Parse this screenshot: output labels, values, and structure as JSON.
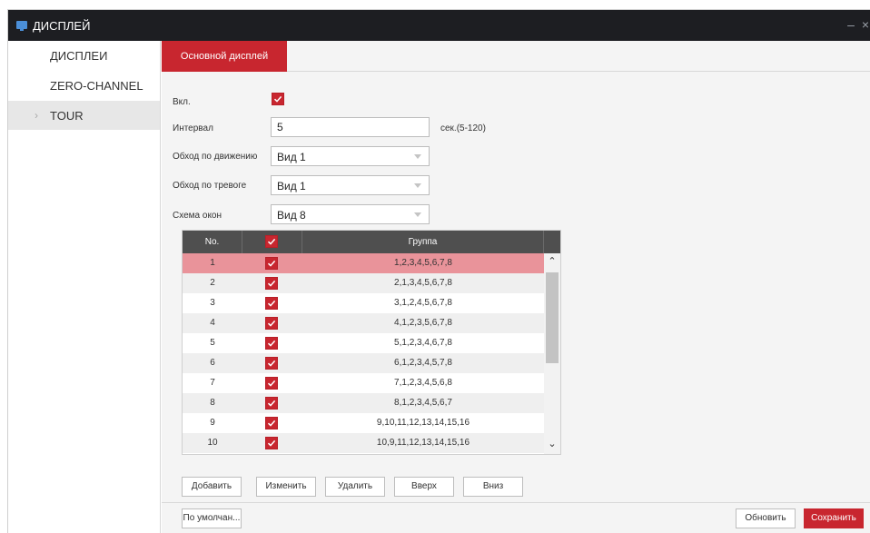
{
  "window": {
    "title": "ДИСПЛЕЙ",
    "controls": "– ×"
  },
  "sidebar": {
    "items": [
      {
        "label": "ДИСПЛЕИ"
      },
      {
        "label": "ZERO-CHANNEL"
      },
      {
        "label": "TOUR",
        "chevron": "›"
      }
    ],
    "active_index": 2
  },
  "tab": {
    "label": "Основной дисплей"
  },
  "form": {
    "enable_label": "Вкл.",
    "enable_checked": true,
    "interval_label": "Интервал",
    "interval_value": "5",
    "interval_hint": "сек.(5-120)",
    "motion_label": "Обход по движению",
    "motion_value": "Вид 1",
    "alarm_label": "Обход по тревоге",
    "alarm_value": "Вид 1",
    "layout_label": "Схема окон",
    "layout_value": "Вид 8"
  },
  "table": {
    "headers": {
      "no": "No.",
      "group": "Группа"
    },
    "selected_row": 1,
    "rows": [
      {
        "no": "1",
        "group": "1,2,3,4,5,6,7,8"
      },
      {
        "no": "2",
        "group": "2,1,3,4,5,6,7,8"
      },
      {
        "no": "3",
        "group": "3,1,2,4,5,6,7,8"
      },
      {
        "no": "4",
        "group": "4,1,2,3,5,6,7,8"
      },
      {
        "no": "5",
        "group": "5,1,2,3,4,6,7,8"
      },
      {
        "no": "6",
        "group": "6,1,2,3,4,5,7,8"
      },
      {
        "no": "7",
        "group": "7,1,2,3,4,5,6,8"
      },
      {
        "no": "8",
        "group": "8,1,2,3,4,5,6,7"
      },
      {
        "no": "9",
        "group": "9,10,11,12,13,14,15,16"
      },
      {
        "no": "10",
        "group": "10,9,11,12,13,14,15,16"
      }
    ]
  },
  "actions": {
    "add": "Добавить",
    "edit": "Изменить",
    "delete": "Удалить",
    "up": "Вверх",
    "down": "Вниз"
  },
  "footer": {
    "default": "По умолчан...",
    "refresh": "Обновить",
    "save": "Сохранить"
  },
  "colors": {
    "accent": "#c8262f",
    "selected_row": "#e9939a",
    "titlebar": "#1d1e22",
    "header": "#4f4f4f"
  }
}
